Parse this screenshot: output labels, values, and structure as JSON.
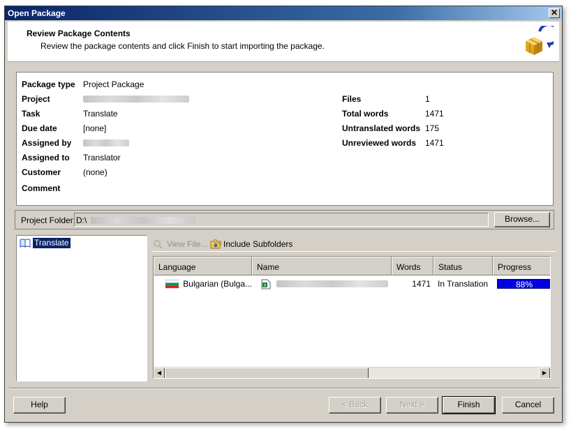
{
  "window": {
    "title": "Open Package",
    "close_glyph": "✕"
  },
  "header": {
    "title": "Review Package Contents",
    "subtitle": "Review the package contents and click Finish to start importing the package.",
    "icon": "package-import-icon"
  },
  "package_info": {
    "package_type_label": "Package type",
    "package_type": "Project Package",
    "project_label": "Project",
    "task_label": "Task",
    "task": "Translate",
    "due_date_label": "Due date",
    "due_date": "[none]",
    "assigned_by_label": "Assigned by",
    "assigned_to_label": "Assigned to",
    "assigned_to": "Translator",
    "customer_label": "Customer",
    "customer": "(none)",
    "comment_label": "Comment",
    "files_label": "Files",
    "files": "1",
    "total_words_label": "Total words",
    "total_words": "1471",
    "untranslated_words_label": "Untranslated words",
    "untranslated_words": "175",
    "unreviewed_words_label": "Unreviewed words",
    "unreviewed_words": "1471"
  },
  "project_folder": {
    "label": "Project Folder:",
    "value": "D:\\",
    "browse_label": "Browse..."
  },
  "tree": {
    "items": [
      {
        "label": "Translate",
        "icon": "task-book-icon",
        "selected": true
      }
    ]
  },
  "toolbar": {
    "view_file_label": "View File...",
    "include_subfolders_label": "Include Subfolders"
  },
  "files_table": {
    "columns": [
      "Language",
      "Name",
      "Words",
      "Status",
      "Progress"
    ],
    "rows": [
      {
        "language": "Bulgarian (Bulga...",
        "flag": "bulgaria-flag",
        "words": "1471",
        "status": "In Translation",
        "progress_label": "88%",
        "progress": 0.88
      }
    ]
  },
  "footer": {
    "help_label": "Help",
    "back_label": "< Back",
    "next_label": "Next >",
    "finish_label": "Finish",
    "cancel_label": "Cancel"
  },
  "colors": {
    "title_bar": "#0a246a",
    "selection": "#0a246a",
    "progress": "#0000e0",
    "dialog_face": "#d4d0c8"
  }
}
